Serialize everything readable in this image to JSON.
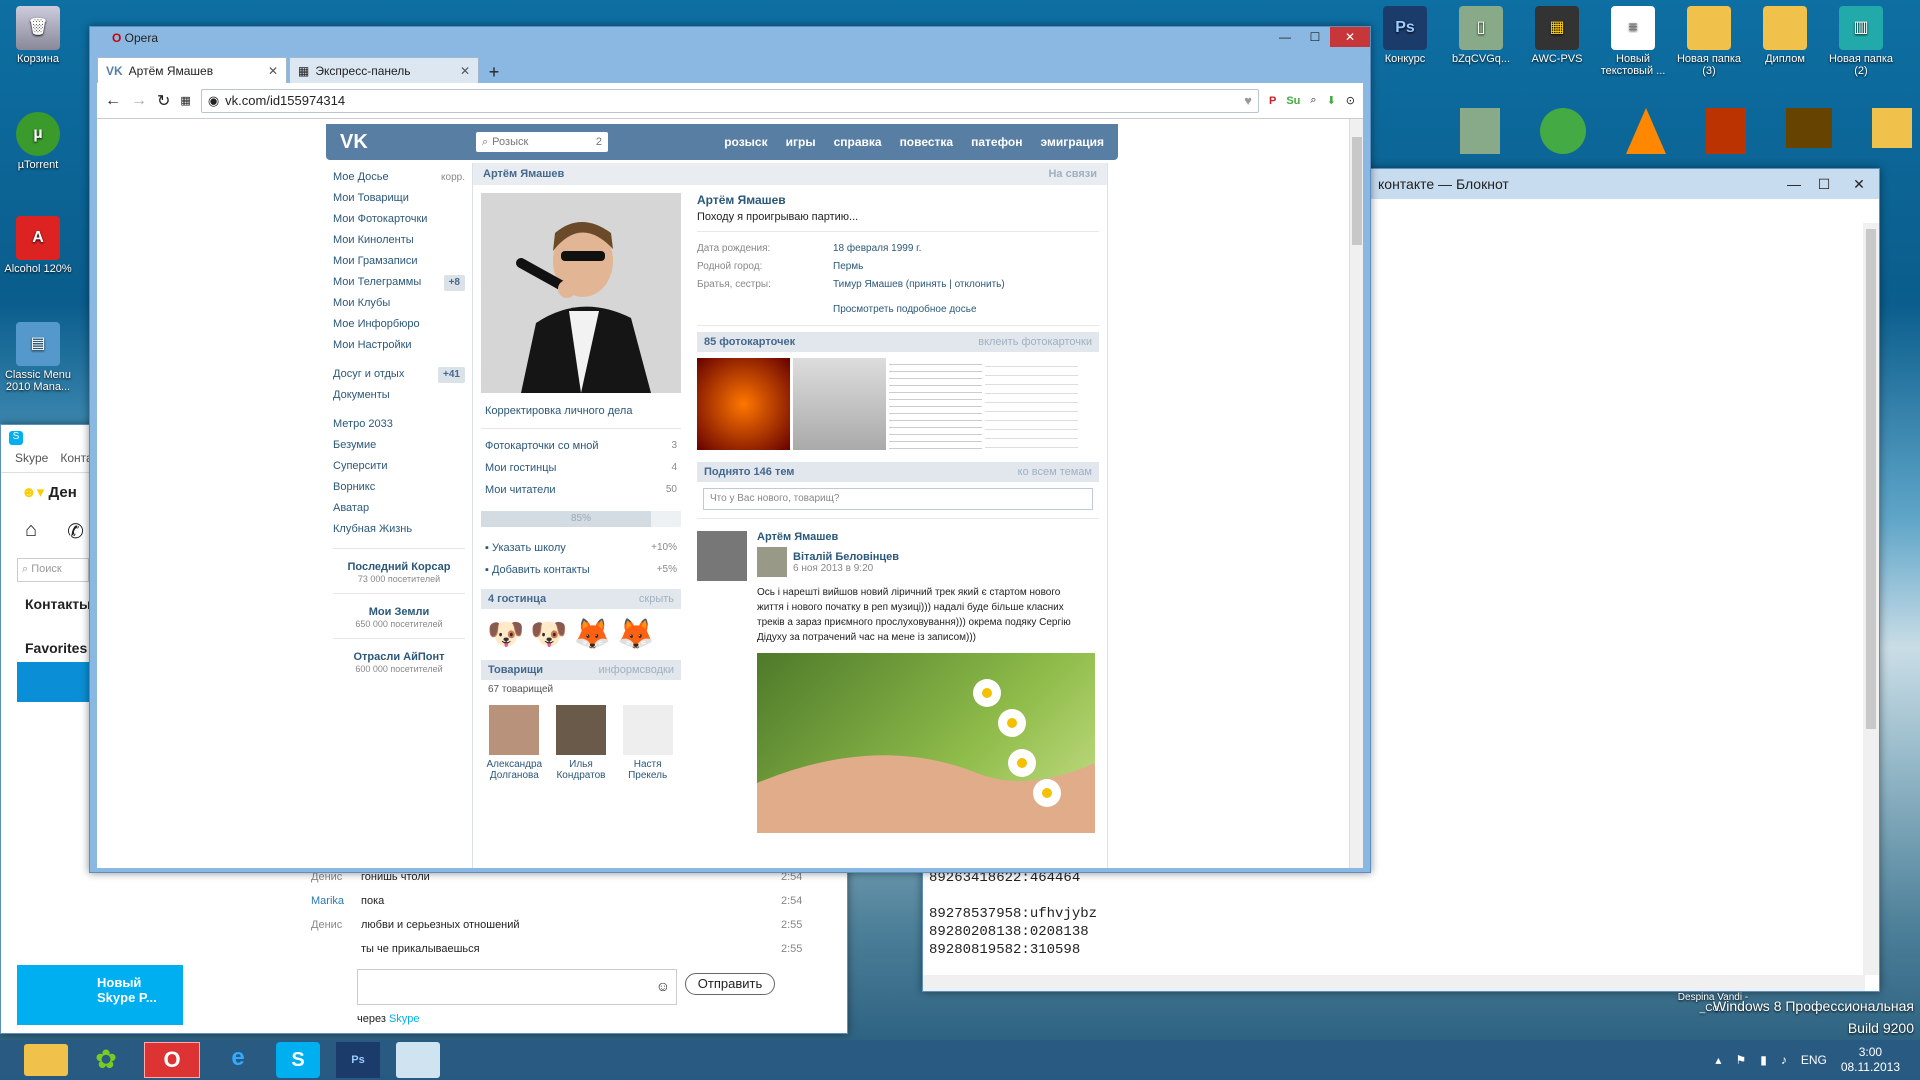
{
  "desktop": {
    "icons_left": [
      {
        "label": "Корзина"
      },
      {
        "label": "µTorrent"
      },
      {
        "label": "Alcohol 120%"
      },
      {
        "label": "Classic Menu 2010 Mana..."
      }
    ],
    "icons_right": [
      {
        "label": "Конкурс"
      },
      {
        "label": "bZqCVGq..."
      },
      {
        "label": "AWC-PVS"
      },
      {
        "label": "Новый текстовый ..."
      },
      {
        "label": "Новая папка (3)"
      },
      {
        "label": "Диплом"
      },
      {
        "label": "Новая папка (2)"
      }
    ],
    "watermark": "Windows 8 Профессиональная",
    "build": "Build 9200",
    "extra_label": "Despina Vandi -_Co..."
  },
  "opera": {
    "title": "Opera",
    "tabs": [
      {
        "label": "Артём Ямашев"
      },
      {
        "label": "Экспресс-панель"
      }
    ],
    "url": "vk.com/id155974314"
  },
  "vk": {
    "logo": "VK",
    "search_placeholder": "Розыск",
    "search_count": "2",
    "menu": [
      "розыск",
      "игры",
      "справка",
      "повестка",
      "патефон",
      "эмиграция"
    ],
    "left": [
      {
        "label": "Мое Досье",
        "extra": "корр."
      },
      {
        "label": "Мои Товарищи"
      },
      {
        "label": "Мои Фотокарточки"
      },
      {
        "label": "Мои Киноленты"
      },
      {
        "label": "Мои Грамзаписи"
      },
      {
        "label": "Мои Телеграммы",
        "count": "+8"
      },
      {
        "label": "Мои Клубы"
      },
      {
        "label": "Мое Инфорбюро"
      },
      {
        "label": "Мои Настройки"
      }
    ],
    "left2": [
      {
        "label": "Досуг и отдых",
        "count": "+41"
      },
      {
        "label": "Документы"
      }
    ],
    "left3": [
      "Метро 2033",
      "Безумие",
      "Суперсити",
      "Ворникс",
      "Аватар",
      "Клубная Жизнь"
    ],
    "groups": [
      {
        "name": "Последний Корсар",
        "count": "73 000 посетителей"
      },
      {
        "name": "Мои Земли",
        "count": "650 000 посетителей"
      },
      {
        "name": "Отрасли АйПонт",
        "count": "600 000 посетителей"
      }
    ],
    "top_name": "Артём Ямашев",
    "online": "На связи",
    "edit": "Корректировка личного дела",
    "links": [
      {
        "label": "Фотокарточки со мной",
        "n": "3"
      },
      {
        "label": "Мои гостинцы",
        "n": "4"
      },
      {
        "label": "Мои читатели",
        "n": "50"
      }
    ],
    "progress": {
      "label": "85%",
      "value": 85
    },
    "tasks": [
      {
        "label": "Указать школу",
        "pct": "+10%"
      },
      {
        "label": "Добавить контакты",
        "pct": "+5%"
      }
    ],
    "gifts_h": "4 гостинца",
    "gifts_r": "скрыть",
    "friends_h": "Товарищи",
    "friends_r": "информсводки",
    "friends_count": "67 товарищей",
    "friends": [
      {
        "name": "Александра Долганова"
      },
      {
        "name": "Илья Кондратов"
      },
      {
        "name": "Настя Прекель"
      }
    ],
    "name": "Артём Ямашев",
    "status": "Походу я проигрываю партию...",
    "info": [
      {
        "k": "Дата рождения:",
        "v": "18 февраля 1999 г."
      },
      {
        "k": "Родной город:",
        "v": "Пермь"
      },
      {
        "k": "Братья, сестры:",
        "v": "Тимур Ямашев (принять | отклонить)"
      }
    ],
    "more": "Просмотреть подробное досье",
    "photos_h": "85 фотокарточек",
    "photos_r": "вклеить фотокарточки",
    "wall_h": "Поднято 146 тем",
    "wall_r": "ко всем темам",
    "wall_placeholder": "Что у Вас нового, товарищ?",
    "post": {
      "author": "Артём Ямашев",
      "repost": "Віталій Беловінцев",
      "date": "6 ноя 2013 в 9:20",
      "text": "Ось і нарешті вийшов новий ліричний трек який є стартом нового життя і нового початку в реп музиці))) надалі буде більше класних треків а зараз приємного прослуховування))) окрема подяку Сергію Дідуху за потрачений час на мене із записом)))"
    }
  },
  "notepad": {
    "title": "контакте — Блокнот",
    "lines": [
      "89263418622:464464",
      "",
      "89278537958:ufhvjybz",
      "89280208138:0208138",
      "89280819582:310598"
    ]
  },
  "skype": {
    "menu": [
      "Skype",
      "Конта"
    ],
    "user": "Ден",
    "search": "Поиск",
    "contacts": "Контакты",
    "favorites": "Favorites",
    "promo": "Новый Skype P...",
    "messages": [
      {
        "who": "Денис",
        "text": "гонишь чтоли",
        "time": "2:54"
      },
      {
        "who": "Marika",
        "text": "пока",
        "time": "2:54"
      },
      {
        "who": "Денис",
        "text": "любви и серьезных отношений",
        "time": "2:55"
      },
      {
        "who": "",
        "text": "ты че прикалываешься",
        "time": "2:55"
      }
    ],
    "send": "Отправить",
    "via": "через",
    "via_skype": "Skype"
  },
  "taskbar": {
    "lang": "ENG",
    "time": "3:00",
    "date": "08.11.2013"
  }
}
